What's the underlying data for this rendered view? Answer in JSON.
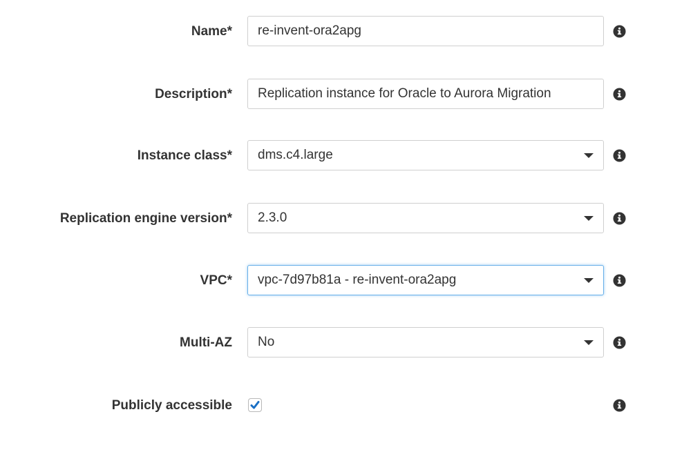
{
  "form": {
    "name": {
      "label": "Name*",
      "value": "re-invent-ora2apg"
    },
    "description": {
      "label": "Description*",
      "value": "Replication instance for Oracle to Aurora Migration"
    },
    "instance_class": {
      "label": "Instance class*",
      "selected": "dms.c4.large"
    },
    "engine_version": {
      "label": "Replication engine version*",
      "selected": "2.3.0"
    },
    "vpc": {
      "label": "VPC*",
      "selected": "vpc-7d97b81a - re-invent-ora2apg"
    },
    "multi_az": {
      "label": "Multi-AZ",
      "selected": "No"
    },
    "publicly_accessible": {
      "label": "Publicly accessible",
      "checked": true
    }
  },
  "icons": {
    "info": "info-circle-icon",
    "dropdown": "caret-down-icon",
    "check": "checkmark-icon"
  },
  "colors": {
    "label_text": "#333333",
    "input_border": "#cfcfcf",
    "focus_border": "#66afe9",
    "checkmark": "#1a6fc4",
    "info_icon": "#333333"
  }
}
